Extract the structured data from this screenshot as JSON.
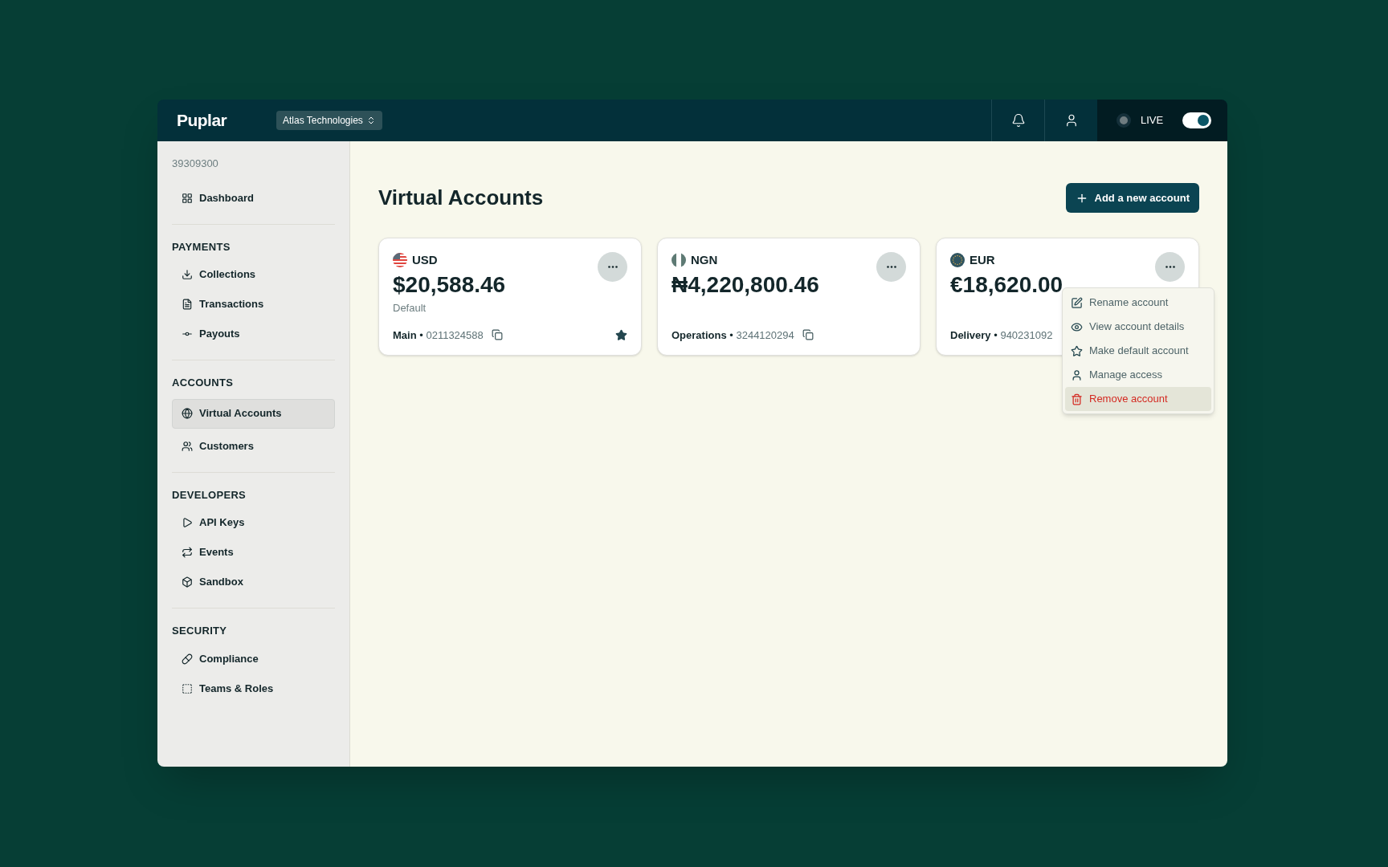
{
  "header": {
    "logo": "Puplar",
    "org_switcher": "Atlas Technologies",
    "mode_label": "LIVE",
    "live": true
  },
  "sidebar": {
    "account_id": "39309300",
    "sections": [
      {
        "items": [
          {
            "label": "Dashboard",
            "selected": false
          }
        ]
      },
      {
        "title": "PAYMENTS",
        "items": [
          {
            "label": "Collections",
            "selected": false
          },
          {
            "label": "Transactions",
            "selected": false
          },
          {
            "label": "Payouts",
            "selected": false
          }
        ]
      },
      {
        "title": "ACCOUNTS",
        "items": [
          {
            "label": "Virtual Accounts",
            "selected": true
          },
          {
            "label": "Customers",
            "selected": false
          }
        ]
      },
      {
        "title": "DEVELOPERS",
        "items": [
          {
            "label": "API Keys",
            "selected": false
          },
          {
            "label": "Events",
            "selected": false
          },
          {
            "label": "Sandbox",
            "selected": false
          }
        ]
      },
      {
        "title": "SECURITY",
        "items": [
          {
            "label": "Compliance",
            "selected": false
          },
          {
            "label": "Teams & Roles",
            "selected": false
          }
        ]
      }
    ]
  },
  "page": {
    "title": "Virtual Accounts",
    "add_button": "Add a new account"
  },
  "cards": [
    {
      "currency": "USD",
      "balance": "$20,588.46",
      "note": "Default",
      "name": "Main",
      "separator": "•",
      "number": "0211324588",
      "copy_visible": true,
      "is_default": true
    },
    {
      "currency": "NGN",
      "balance": "₦4,220,800.46",
      "name": "Operations",
      "separator": "•",
      "number": "3244120294",
      "copy_visible": true,
      "is_default": false
    },
    {
      "currency": "EUR",
      "balance": "€18,620.00",
      "name": "Delivery",
      "separator": "•",
      "number": "940231092",
      "copy_visible": false,
      "is_default": false
    }
  ],
  "menu": {
    "items": [
      {
        "label": "Rename account",
        "kind": "normal",
        "selected": false
      },
      {
        "label": "View account details",
        "kind": "normal",
        "selected": false
      },
      {
        "label": "Make default account",
        "kind": "normal",
        "selected": false
      },
      {
        "label": "Manage access",
        "kind": "normal",
        "selected": false
      },
      {
        "label": "Remove account",
        "kind": "danger",
        "selected": true
      }
    ]
  }
}
